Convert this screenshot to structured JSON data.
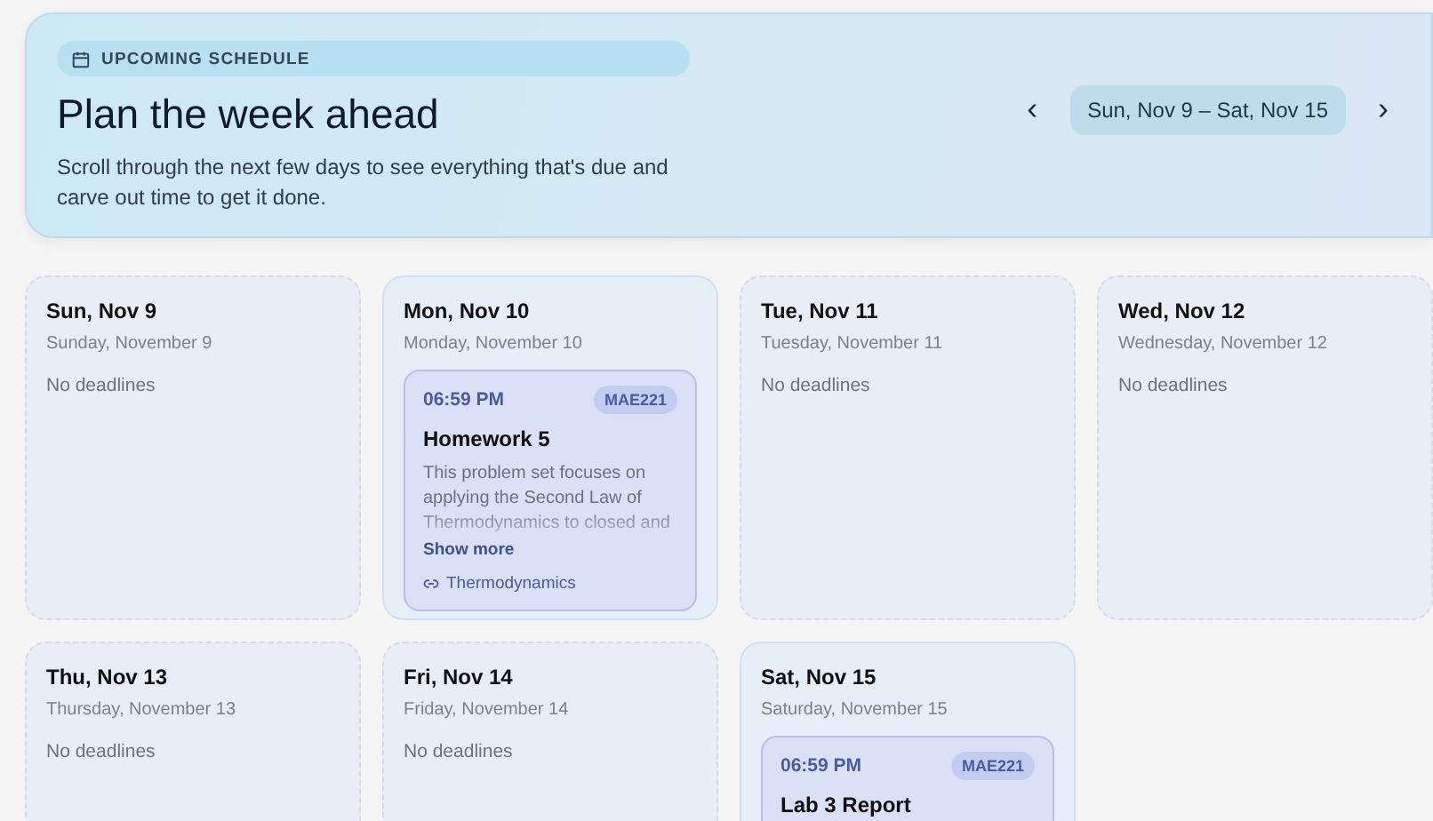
{
  "header": {
    "badge": "UPCOMING SCHEDULE",
    "title": "Plan the week ahead",
    "subtitle": "Scroll through the next few days to see everything that's due and carve out time to get it done.",
    "prev": "‹",
    "range": "Sun, Nov 9 – Sat, Nov 15",
    "next": "›"
  },
  "days": [
    {
      "short": "Sun, Nov 9",
      "long": "Sunday, November 9",
      "empty_text": "No deadlines"
    },
    {
      "short": "Mon, Nov 10",
      "long": "Monday, November 10",
      "events": [
        {
          "time": "06:59 PM",
          "course": "MAE221",
          "title": "Homework 5",
          "description": "This problem set focuses on applying the Second Law of Thermodynamics to closed and",
          "show_more": "Show more",
          "link": "Thermodynamics"
        }
      ]
    },
    {
      "short": "Tue, Nov 11",
      "long": "Tuesday, November 11",
      "empty_text": "No deadlines"
    },
    {
      "short": "Wed, Nov 12",
      "long": "Wednesday, November 12",
      "empty_text": "No deadlines"
    },
    {
      "short": "Thu, Nov 13",
      "long": "Thursday, November 13",
      "empty_text": "No deadlines"
    },
    {
      "short": "Fri, Nov 14",
      "long": "Friday, November 14",
      "empty_text": "No deadlines"
    },
    {
      "short": "Sat, Nov 15",
      "long": "Saturday, November 15",
      "events": [
        {
          "time": "06:59 PM",
          "course": "MAE221",
          "title": "Lab 3 Report"
        }
      ]
    }
  ]
}
